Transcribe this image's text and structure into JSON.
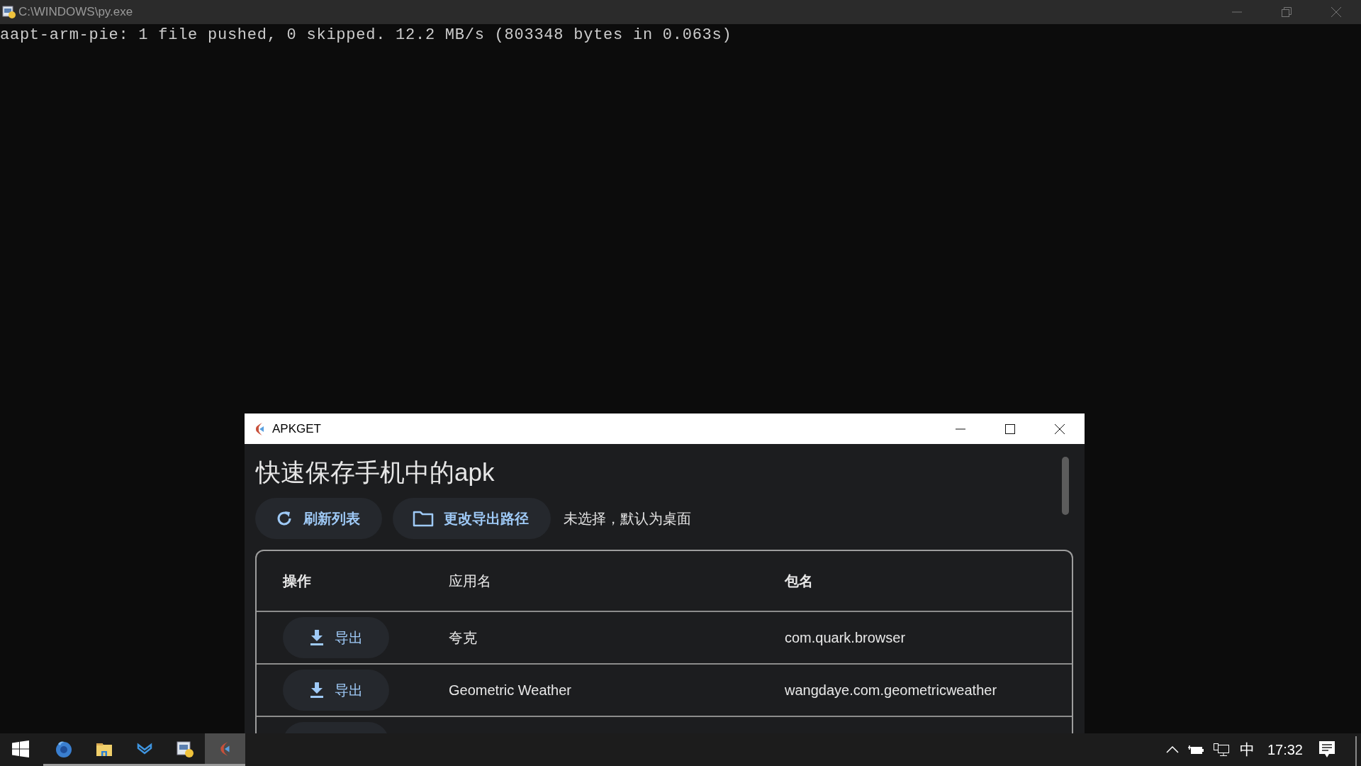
{
  "console": {
    "title": "C:\\WINDOWS\\py.exe",
    "lines": [
      "aapt-arm-pie: 1 file pushed, 0 skipped. 12.2 MB/s (803348 bytes in 0.063s)"
    ]
  },
  "app_window": {
    "title": "APKGET",
    "heading": "快速保存手机中的apk",
    "refresh_button": "刷新列表",
    "path_button": "更改导出路径",
    "path_status": "未选择，默认为桌面",
    "table": {
      "columns": [
        "操作",
        "应用名",
        "包名"
      ],
      "rows": [
        {
          "action": "导出",
          "app_name": "夸克",
          "package": "com.quark.browser"
        },
        {
          "action": "导出",
          "app_name": "Geometric Weather",
          "package": "wangdaye.com.geometricweather"
        }
      ]
    }
  },
  "taskbar": {
    "apps": [
      {
        "kind": "firefox",
        "running": true,
        "selected": false
      },
      {
        "kind": "explorer",
        "running": true,
        "selected": false
      },
      {
        "kind": "mail",
        "running": true,
        "selected": false
      },
      {
        "kind": "python",
        "running": true,
        "selected": false
      },
      {
        "kind": "apkget",
        "running": true,
        "selected": true
      }
    ],
    "tray": {
      "input_method": "中",
      "time": "17:32"
    }
  }
}
